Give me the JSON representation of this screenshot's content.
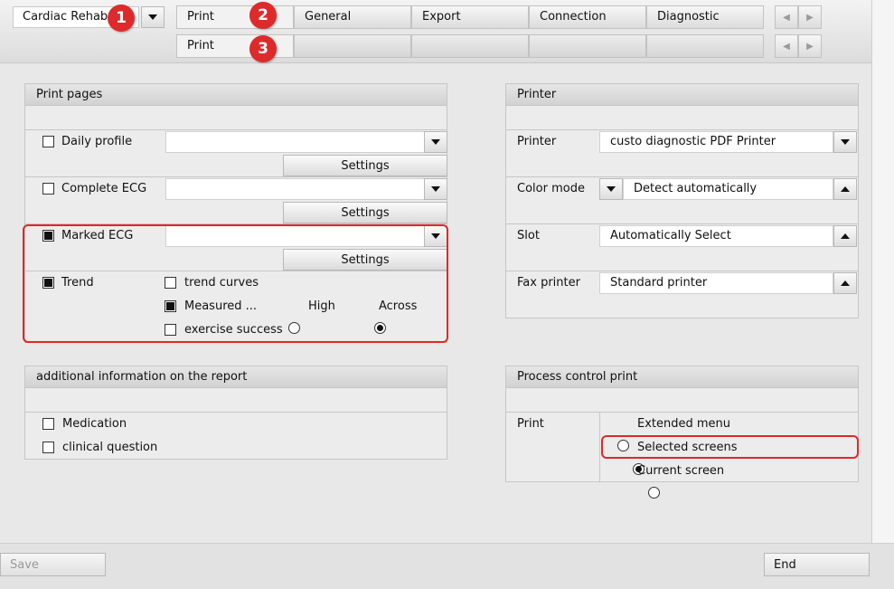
{
  "toolbar": {
    "module_select": "Cardiac Rehab",
    "tabs_row1": [
      "Print",
      "General",
      "Export",
      "Connection",
      "Diagnostic"
    ],
    "tabs_row2": [
      "Print",
      "",
      "",
      "",
      ""
    ],
    "badges": [
      "1",
      "2",
      "3"
    ]
  },
  "print_pages": {
    "title": "Print pages",
    "daily_profile": {
      "label": "Daily profile",
      "checked": false,
      "settings": "Settings"
    },
    "complete_ecg": {
      "label": "Complete ECG",
      "checked": false,
      "settings": "Settings"
    },
    "marked_ecg": {
      "label": "Marked ECG",
      "checked": true,
      "settings": "Settings"
    },
    "trend": {
      "label": "Trend",
      "checked": true,
      "trend_curves": "trend curves",
      "measured": "Measured ...",
      "high": "High",
      "across": "Across",
      "exercise_success": "exercise success"
    }
  },
  "additional_info": {
    "title": "additional information on the report",
    "medication": "Medication",
    "clinical_question": "clinical question"
  },
  "printer": {
    "title": "Printer",
    "printer_label": "Printer",
    "printer_value": "custo diagnostic PDF Printer",
    "color_mode_label": "Color mode",
    "color_mode_value": "Detect automatically",
    "slot_label": "Slot",
    "slot_value": "Automatically Select",
    "fax_label": "Fax printer",
    "fax_value": "Standard printer"
  },
  "process_control": {
    "title": "Process control print",
    "print_label": "Print",
    "options": [
      "Extended menu",
      "Selected screens",
      "Current screen"
    ],
    "selected_index": 1
  },
  "footer": {
    "save": "Save",
    "end": "End"
  },
  "colors": {
    "highlight": "#e02828",
    "badge": "#dd2b2b"
  }
}
